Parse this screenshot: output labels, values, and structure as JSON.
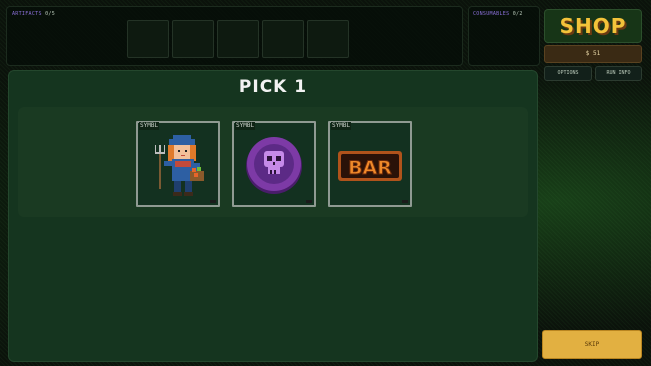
{
  "top": {
    "artifacts_label": "ARTIFACTS",
    "artifacts_count": "0/5",
    "consumables_label": "CONSUMABLES",
    "consumables_count": "0/2"
  },
  "shop": {
    "title": "SHOP",
    "money": "$ 51",
    "options_label": "OPTIONS",
    "run_info_label": "RUN INFO",
    "skip_label": "SKIP"
  },
  "main": {
    "pick_label": "PICK 1"
  },
  "cards": [
    {
      "tag": "SYMBL",
      "icon": "farmer-icon"
    },
    {
      "tag": "SYMBL",
      "icon": "skull-coin-icon"
    },
    {
      "tag": "SYMBL",
      "icon": "bar-symbol-icon",
      "icon_text": "BAR"
    }
  ],
  "colors": {
    "accent_gold": "#e2b041",
    "shop_title": "#f3c33a",
    "panel_green": "#15351f",
    "purple_coin": "#7d3aa6"
  }
}
